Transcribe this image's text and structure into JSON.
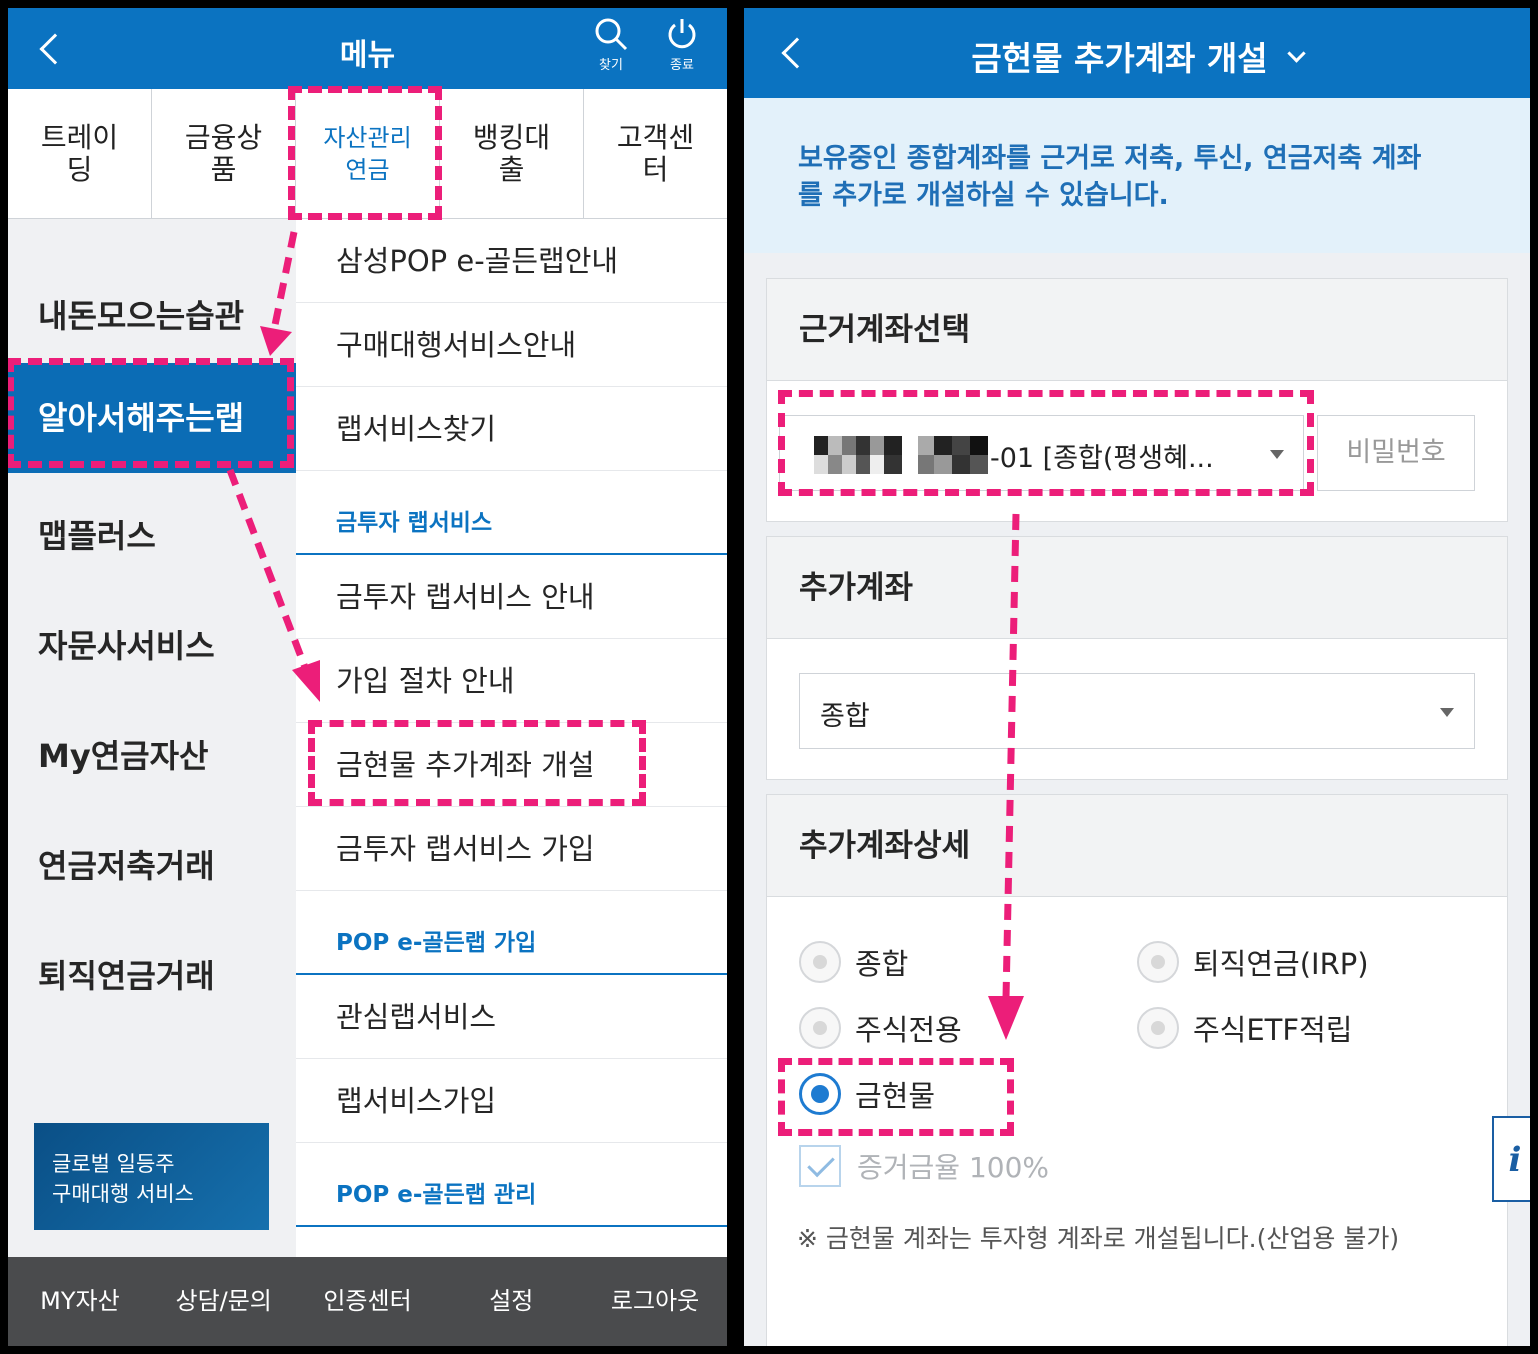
{
  "left": {
    "header": {
      "title": "메뉴",
      "search_label": "찾기",
      "power_label": "종료"
    },
    "categories": [
      {
        "label": "트레이딩"
      },
      {
        "label": "금융상품"
      },
      {
        "label": "자산관리연금"
      },
      {
        "label": "뱅킹대출"
      },
      {
        "label": "고객센터"
      }
    ],
    "sidebar": [
      {
        "label": "내돈모으는습관"
      },
      {
        "label": "알아서해주는랩"
      },
      {
        "label": "맵플러스"
      },
      {
        "label": "자문사서비스"
      },
      {
        "label": "My연금자산"
      },
      {
        "label": "연금저축거래"
      },
      {
        "label": "퇴직연금거래"
      }
    ],
    "promo": {
      "line1": "글로벌 일등주",
      "line2": "구매대행 서비스"
    },
    "submenu": [
      {
        "label": "삼성POP e-골든랩안내",
        "type": "item"
      },
      {
        "label": "구매대행서비스안내",
        "type": "item"
      },
      {
        "label": "랩서비스찾기",
        "type": "item"
      },
      {
        "label": "금투자 랩서비스",
        "type": "header"
      },
      {
        "label": "금투자 랩서비스 안내",
        "type": "item"
      },
      {
        "label": "가입 절차 안내",
        "type": "item"
      },
      {
        "label": "금현물 추가계좌 개설",
        "type": "item"
      },
      {
        "label": "금투자 랩서비스 가입",
        "type": "item"
      },
      {
        "label": "POP e-골든랩 가입",
        "type": "header"
      },
      {
        "label": "관심랩서비스",
        "type": "item"
      },
      {
        "label": "랩서비스가입",
        "type": "item"
      },
      {
        "label": "POP e-골든랩 관리",
        "type": "header"
      }
    ],
    "footer": [
      {
        "label": "MY자산"
      },
      {
        "label": "상담/문의"
      },
      {
        "label": "인증센터"
      },
      {
        "label": "설정"
      },
      {
        "label": "로그아웃"
      }
    ]
  },
  "right": {
    "header": {
      "title": "금현물 추가계좌 개설"
    },
    "notice": {
      "line1": "보유중인 종합계좌를 근거로  저축, 투신, 연금저축 계좌",
      "line2": "를 추가로 개설하실 수 있습니다."
    },
    "base_account": {
      "title": "근거계좌선택",
      "value": "-01 [종합(평생혜...",
      "password_placeholder": "비밀번호"
    },
    "add_account": {
      "title": "추가계좌",
      "value": "종합"
    },
    "detail": {
      "title": "추가계좌상세",
      "options": [
        {
          "label": "종합",
          "checked": false
        },
        {
          "label": "퇴직연금(IRP)",
          "checked": false
        },
        {
          "label": "주식전용",
          "checked": false
        },
        {
          "label": "주식ETF적립",
          "checked": false
        },
        {
          "label": "금현물",
          "checked": true
        }
      ],
      "margin_label": "증거금율 100%",
      "note": "※ 금현물 계좌는 투자형 계좌로 개설됩니다.(산업용 불가)"
    },
    "info_label": "i"
  },
  "colors": {
    "header_blue": "#0b73c1",
    "highlight": "#ec1e79",
    "footer_gray": "#4a4b4d",
    "notice_bg": "#e3f1fa"
  }
}
